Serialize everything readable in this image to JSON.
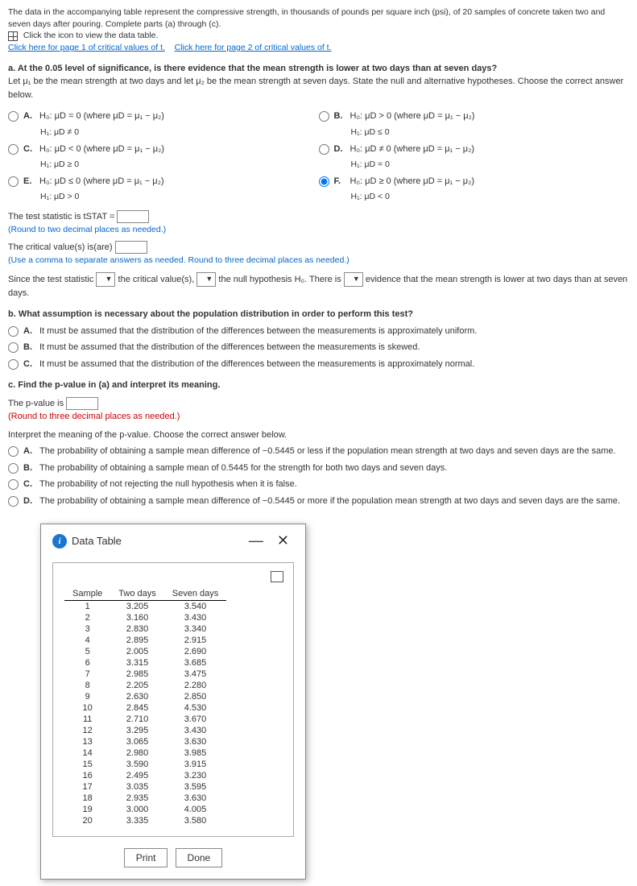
{
  "intro": {
    "text": "The data in the accompanying table represent the compressive strength, in thousands of pounds per square inch (psi), of 20 samples of concrete taken two and seven days after pouring. Complete parts (a) through (c).",
    "icon_click": "Click the icon to view the data table.",
    "link1": "Click here for page 1 of critical values of t.",
    "link2": "Click here for page 2 of critical values of t."
  },
  "part_a": {
    "header": "a. At the 0.05 level of significance, is there evidence that the mean strength is lower at two days than at seven days?",
    "let_line": "Let μ₁ be the mean strength at two days and let μ₂ be the mean strength at seven days. State the null and alternative hypotheses. Choose the correct answer below.",
    "options": {
      "A": {
        "h0": "H₀: μD = 0 (where μD = μ₁ − μ₂)",
        "h1": "H₁: μD ≠ 0"
      },
      "B": {
        "h0": "H₀: μD > 0 (where μD = μ₁ − μ₂)",
        "h1": "H₁: μD ≤ 0"
      },
      "C": {
        "h0": "H₀: μD < 0 (where μD = μ₁ − μ₂)",
        "h1": "H₁: μD ≥ 0"
      },
      "D": {
        "h0": "H₀: μD ≠ 0 (where μD = μ₁ − μ₂)",
        "h1": "H₁: μD = 0"
      },
      "E": {
        "h0": "H₀: μD ≤ 0 (where μD = μ₁ − μ₂)",
        "h1": "H₁: μD > 0"
      },
      "F": {
        "h0": "H₀: μD ≥ 0 (where μD = μ₁ − μ₂)",
        "h1": "H₁: μD < 0"
      }
    },
    "tstat_label": "The test statistic is tSTAT =",
    "round2": "(Round to two decimal places as needed.)",
    "crit_label": "The critical value(s) is(are)",
    "comma_note": "(Use a comma to separate answers as needed. Round to three decimal places as needed.)",
    "sentence": {
      "p1": "Since the test statistic",
      "p2": "the critical value(s),",
      "p3": "the null hypothesis H₀. There is",
      "p4": "evidence that the mean strength is lower at two days than at seven days."
    }
  },
  "part_b": {
    "header": "b. What assumption is necessary about the population distribution in order to perform this test?",
    "options": {
      "A": "It must be assumed that the distribution of the differences between the measurements is approximately uniform.",
      "B": "It must be assumed that the distribution of the differences between the measurements is skewed.",
      "C": "It must be assumed that the distribution of the differences between the measurements is approximately normal."
    }
  },
  "part_c": {
    "header": "c. Find the p-value in (a) and interpret its meaning.",
    "pval_label": "The p-value is",
    "round3": "(Round to three decimal places as needed.)",
    "interp_header": "Interpret the meaning of the p-value. Choose the correct answer below.",
    "options": {
      "A": "The probability of obtaining a sample mean difference of −0.5445 or less if the population mean strength at two days and seven days are the same.",
      "B": "The probability of obtaining a sample mean of 0.5445 for the strength for both two days and seven days.",
      "C": "The probability of not rejecting the null hypothesis when it is false.",
      "D": "The probability of obtaining a sample mean difference of −0.5445 or more if the population mean strength at two days and seven days are the same."
    }
  },
  "dialog": {
    "title": "Data Table",
    "headers": {
      "c1": "Sample",
      "c2": "Two days",
      "c3": "Seven days"
    },
    "rows": [
      {
        "s": "1",
        "t2": "3.205",
        "t7": "3.540"
      },
      {
        "s": "2",
        "t2": "3.160",
        "t7": "3.430"
      },
      {
        "s": "3",
        "t2": "2.830",
        "t7": "3.340"
      },
      {
        "s": "4",
        "t2": "2.895",
        "t7": "2.915"
      },
      {
        "s": "5",
        "t2": "2.005",
        "t7": "2.690"
      },
      {
        "s": "6",
        "t2": "3.315",
        "t7": "3.685"
      },
      {
        "s": "7",
        "t2": "2.985",
        "t7": "3.475"
      },
      {
        "s": "8",
        "t2": "2.205",
        "t7": "2.280"
      },
      {
        "s": "9",
        "t2": "2.630",
        "t7": "2.850"
      },
      {
        "s": "10",
        "t2": "2.845",
        "t7": "4.530"
      },
      {
        "s": "11",
        "t2": "2.710",
        "t7": "3.670"
      },
      {
        "s": "12",
        "t2": "3.295",
        "t7": "3.430"
      },
      {
        "s": "13",
        "t2": "3.065",
        "t7": "3.630"
      },
      {
        "s": "14",
        "t2": "2.980",
        "t7": "3.985"
      },
      {
        "s": "15",
        "t2": "3.590",
        "t7": "3.915"
      },
      {
        "s": "16",
        "t2": "2.495",
        "t7": "3.230"
      },
      {
        "s": "17",
        "t2": "3.035",
        "t7": "3.595"
      },
      {
        "s": "18",
        "t2": "2.935",
        "t7": "3.630"
      },
      {
        "s": "19",
        "t2": "3.000",
        "t7": "4.005"
      },
      {
        "s": "20",
        "t2": "3.335",
        "t7": "3.580"
      }
    ],
    "print": "Print",
    "done": "Done"
  }
}
